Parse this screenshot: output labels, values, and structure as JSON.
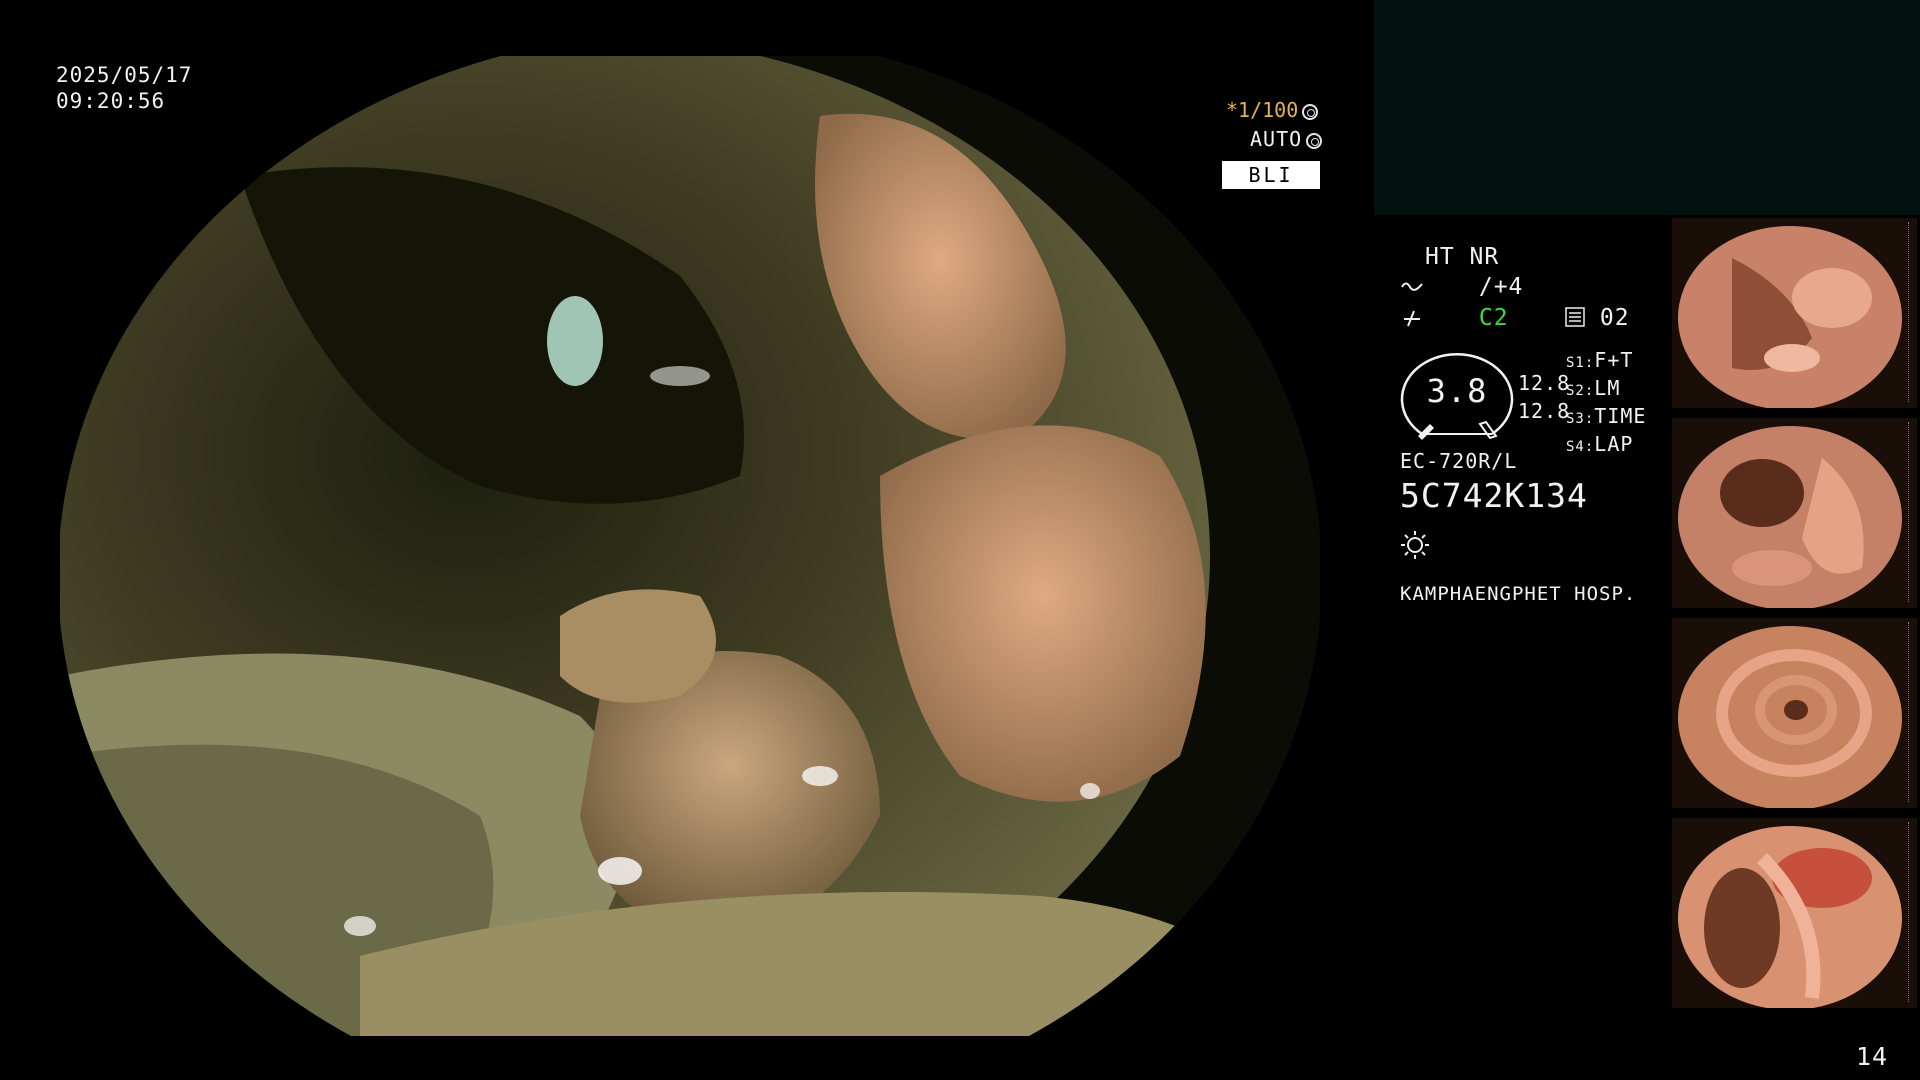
{
  "header": {
    "date": "2025/05/17",
    "time": "09:20:56"
  },
  "exposure": {
    "shutter": "*1/100",
    "auto_label": "AUTO",
    "mode_badge": "BLI"
  },
  "settings": {
    "ht_nr": "HT NR",
    "structure_value": "/+4",
    "color_value": "C2",
    "frame_counter": "02",
    "zoom_value": "3.8",
    "readout_1": "12.8",
    "readout_2": "12.8",
    "switches": [
      {
        "key": "S1:",
        "value": "F+T"
      },
      {
        "key": "S2:",
        "value": "LM"
      },
      {
        "key": "S3:",
        "value": "TIME"
      },
      {
        "key": "S4:",
        "value": "LAP"
      }
    ]
  },
  "scope": {
    "model": "EC-720R/L",
    "serial": "5C742K134"
  },
  "hospital": "KAMPHAENGPHET HOSP.",
  "page_number": "14",
  "icons": [
    "structure-icon",
    "color-icon",
    "frame-counter-icon",
    "brightness-icon",
    "shutter-icon",
    "iris-icon"
  ],
  "colors": {
    "shutter": "#e8b14a",
    "color_mode": "#3ddc3d",
    "panel": "#02120f"
  }
}
